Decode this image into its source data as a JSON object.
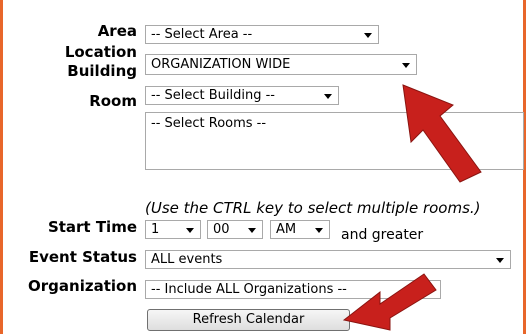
{
  "form": {
    "area": {
      "label": "Area",
      "value": "-- Select Area --"
    },
    "location": {
      "label": "Location",
      "value": "ORGANIZATION WIDE"
    },
    "building": {
      "label": "Building",
      "value": "-- Select Building --"
    },
    "room": {
      "label": "Room",
      "value": "-- Select Rooms --"
    },
    "hint": "(Use the CTRL key to select multiple rooms.)",
    "start_time": {
      "label": "Start Time",
      "hour": "1",
      "minute": "00",
      "ampm": "AM",
      "suffix": "and greater"
    },
    "event_status": {
      "label": "Event Status",
      "value": "ALL events"
    },
    "organization": {
      "label": "Organization",
      "value": "-- Include ALL Organizations --"
    },
    "refresh_label": "Refresh Calendar"
  },
  "colors": {
    "frame": "#e8662a",
    "arrow": "#c8201c"
  }
}
